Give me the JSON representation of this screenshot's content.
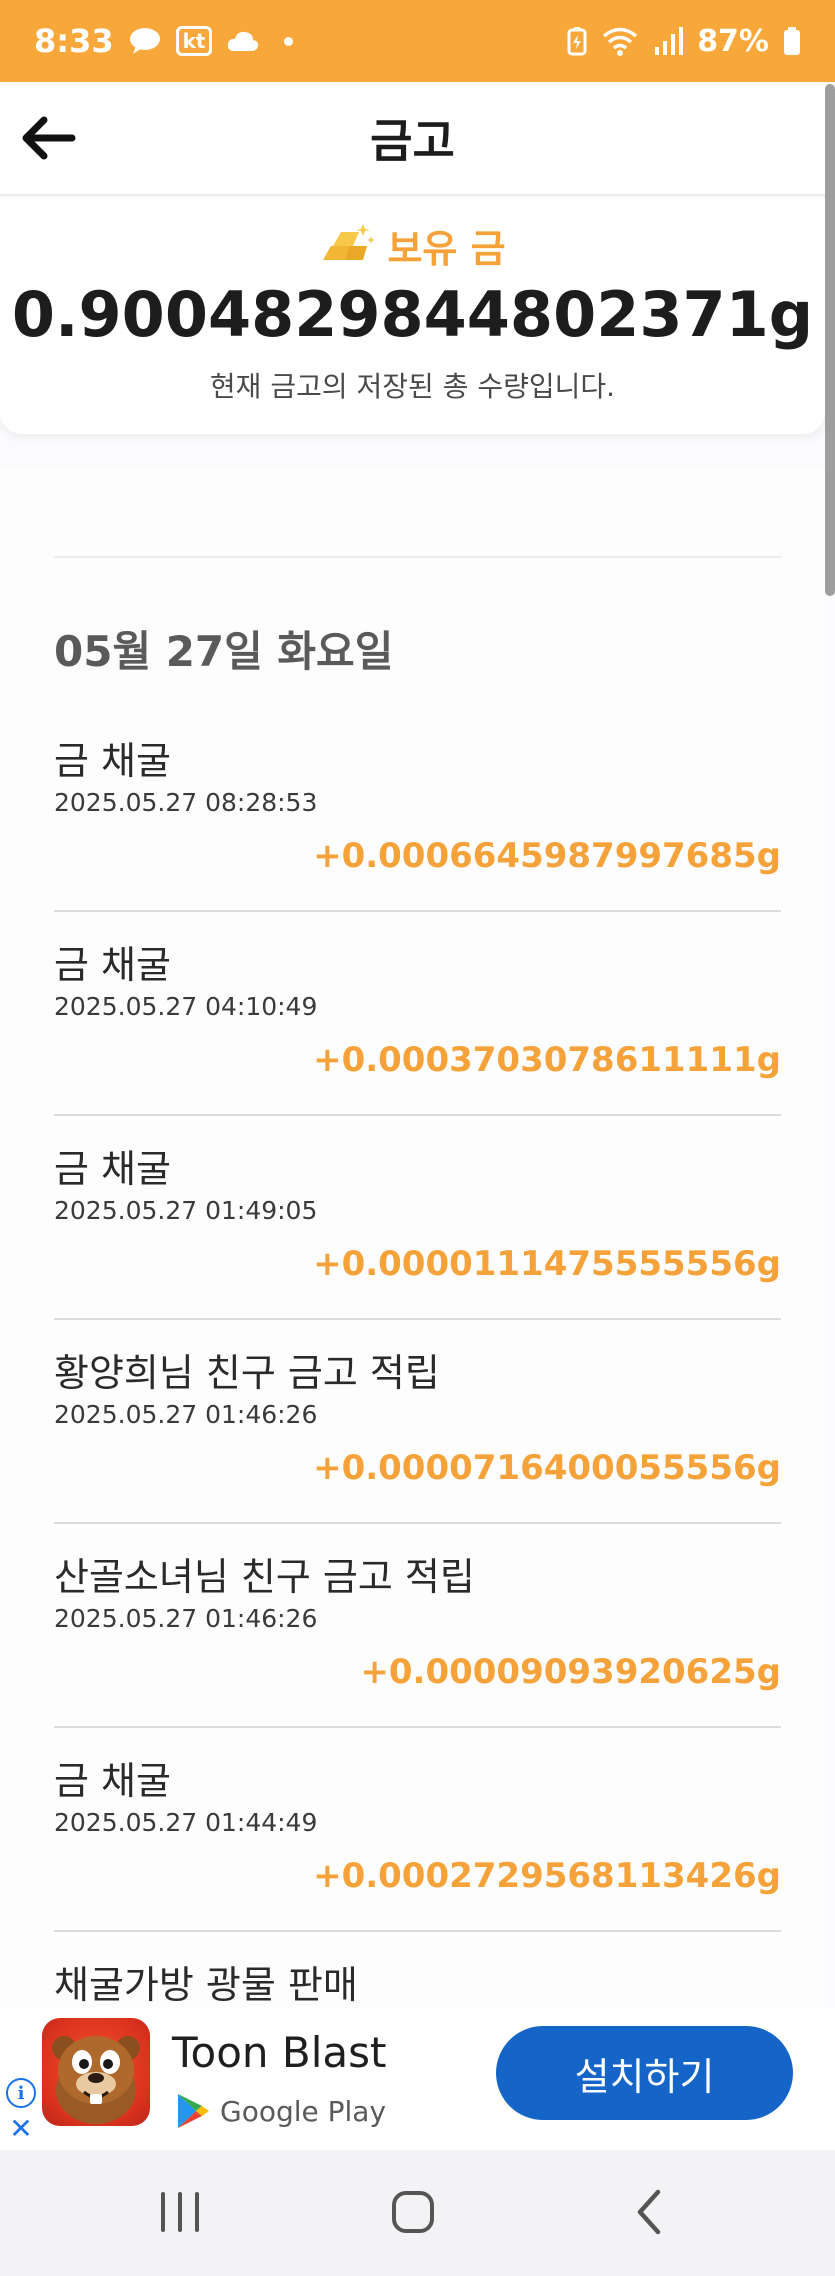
{
  "status_bar": {
    "time": "8:33",
    "carrier": "kt",
    "battery": "87%"
  },
  "header": {
    "title": "금고"
  },
  "balance": {
    "label": "보유 금",
    "value": "0.9004829844802371g",
    "description": "현재 금고의 저장된 총 수량입니다."
  },
  "history": {
    "date_header": "05월 27일 화요일",
    "entries": [
      {
        "title": "금 채굴",
        "time": "2025.05.27 08:28:53",
        "amount": "+0.0006645987997685g"
      },
      {
        "title": "금 채굴",
        "time": "2025.05.27 04:10:49",
        "amount": "+0.0003703078611111g"
      },
      {
        "title": "금 채굴",
        "time": "2025.05.27 01:49:05",
        "amount": "+0.0000111475555556g"
      },
      {
        "title": "황양희님 친구 금고 적립",
        "time": "2025.05.27 01:46:26",
        "amount": "+0.0000716400055556g"
      },
      {
        "title": "산골소녀님 친구 금고 적립",
        "time": "2025.05.27 01:46:26",
        "amount": "+0.00009093920625g"
      },
      {
        "title": "금 채굴",
        "time": "2025.05.27 01:44:49",
        "amount": "+0.0002729568113426g"
      },
      {
        "title": "채굴가방 광물 판매",
        "time": "",
        "amount": ""
      }
    ]
  },
  "ad": {
    "app_name": "Toon Blast",
    "store": "Google Play",
    "install_label": "설치하기"
  },
  "colors": {
    "accent": "#f6a23a",
    "status_bar": "#f8a83a",
    "install_button": "#1565c8"
  }
}
